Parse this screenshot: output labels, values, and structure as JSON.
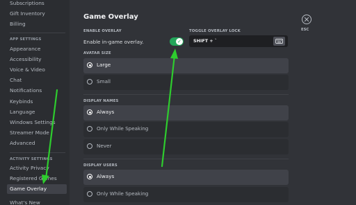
{
  "sidebar": {
    "items_top": [
      "Subscriptions",
      "Gift Inventory",
      "Billing"
    ],
    "app_settings_header": "APP SETTINGS",
    "app_items": [
      "Appearance",
      "Accessibility",
      "Voice & Video",
      "Chat",
      "Notifications",
      "Keybinds",
      "Language",
      "Windows Settings",
      "Streamer Mode",
      "Advanced"
    ],
    "activity_header": "ACTIVITY SETTINGS",
    "activity_items": [
      "Activity Privacy",
      "Registered Games",
      "Game Overlay"
    ],
    "bottom_item": "What's New",
    "active_item": "Game Overlay"
  },
  "main": {
    "title": "Game Overlay",
    "enable_overlay": {
      "header": "ENABLE OVERLAY",
      "label": "Enable in-game overlay.",
      "enabled": true,
      "accent_color": "#23a55a"
    },
    "toggle_lock": {
      "header": "TOGGLE OVERLAY LOCK",
      "keybind": "SHIFT + `"
    },
    "avatar_size": {
      "header": "AVATAR SIZE",
      "options": [
        "Large",
        "Small"
      ],
      "selected": "Large"
    },
    "display_names": {
      "header": "DISPLAY NAMES",
      "options": [
        "Always",
        "Only While Speaking",
        "Never"
      ],
      "selected": "Always"
    },
    "display_users": {
      "header": "DISPLAY USERS",
      "options": [
        "Always",
        "Only While Speaking"
      ],
      "selected": "Always"
    },
    "close": {
      "label": "ESC",
      "icon": "close-icon"
    }
  },
  "annotations": {
    "arrow_color": "#2ecc2e"
  }
}
